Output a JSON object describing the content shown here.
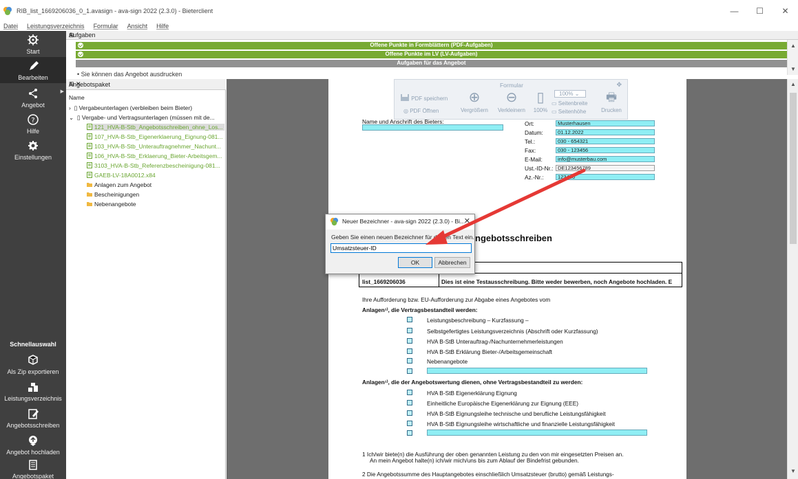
{
  "window": {
    "title": "RIB_list_1669206036_0_1.avasign - ava-sign 2022 (2.3.0) - Bieterclient",
    "controls": [
      "—",
      "☐",
      "✕"
    ]
  },
  "menu": [
    "Datei",
    "Leistungsverzeichnis",
    "Formular",
    "Ansicht",
    "Hilfe"
  ],
  "sidebar": {
    "items": [
      {
        "label": "Start",
        "icon": "gear-wheel-icon"
      },
      {
        "label": "Bearbeiten",
        "icon": "pencil-icon"
      },
      {
        "label": "Angebot",
        "icon": "share-icon"
      },
      {
        "label": "Hilfe",
        "icon": "help-icon"
      },
      {
        "label": "Einstellungen",
        "icon": "settings-icon"
      }
    ],
    "quick_title": "Schnellauswahl",
    "quick_items": [
      {
        "label": "Als Zip exportieren",
        "icon": "zip-icon"
      },
      {
        "label": "Leistungsverzeichnis",
        "icon": "coins-icon"
      },
      {
        "label": "Angebotsschreiben",
        "icon": "edit-doc-icon"
      },
      {
        "label": "Angebot hochladen",
        "icon": "upload-icon"
      },
      {
        "label": "Angebotspaket",
        "icon": "package-icon"
      }
    ]
  },
  "aufgaben": {
    "header": "Aufgaben",
    "rows": [
      "Offene Punkte in Formblättern (PDF-Aufgaben)",
      "Offene Punkte im LV (LV-Aufgaben)",
      "Aufgaben für das Angebot"
    ],
    "info": "Sie können das Angebot ausdrucken"
  },
  "tree": {
    "header": "Angebotspaket",
    "column": "Name",
    "nodes": [
      "Vergabeunterlagen (verbleiben beim Bieter)",
      "Vergabe- und Vertragsunterlagen (müssen mit de...",
      "121_HVA-B-Stb_Angebotsschreiben_ohne_Los...",
      "107_HVA-B-Stb_Eigenerklaerung_Eignung-081...",
      "103_HVA-B-Stb_Unterauftragnehmer_Nachunt...",
      "106_HVA-B-Stb_Erklaerung_Bieter-Arbeitsgem...",
      "3103_HVA-B-Stb_Referenzbescheinigung-081...",
      "GAEB-LV-18A0012.x84",
      "Anlagen zum Angebot",
      "Bescheinigungen",
      "Nebenangebote"
    ]
  },
  "toolbar": {
    "title": "Formular",
    "pdf_save": "PDF speichern",
    "pdf_open": "PDF Öffnen",
    "zoom_in": "Vergrößern",
    "zoom_out": "Verkleinern",
    "zoom_level": "100%",
    "zoom_select": "100%",
    "page_width": "Seitenbreite",
    "page_height": "Seitenhöhe",
    "print": "Drucken"
  },
  "document": {
    "bidder_label": "Name und Anschrift des Bieters:",
    "contact": [
      {
        "label": "Ort:",
        "value": "Musterhausen"
      },
      {
        "label": "Datum:",
        "value": "01.12.2022"
      },
      {
        "label": "Tel.:",
        "value": "030 - 654321"
      },
      {
        "label": "Fax:",
        "value": "030 - 123456"
      },
      {
        "label": "E-Mail:",
        "value": "info@musterbau.com"
      },
      {
        "label": "Ust.-ID-Nr.:",
        "value": "DE123456789"
      },
      {
        "label": "Az.-Nr.:",
        "value": "123456"
      }
    ],
    "heading": "ngebotsschreiben",
    "table_id": "list_1669206036",
    "table_text": "Dies ist eine Testausschreibung. Bitte weder bewerben, noch Angebote hochladen. E",
    "intro": "Ihre Aufforderung bzw. EU-Aufforderung zur Abgabe eines Angebotes vom",
    "section1_title": "Anlagen¹⁾, die Vertragsbestandteil werden:",
    "section1_items": [
      "Leistungsbeschreibung – Kurzfassung –",
      "Selbstgefertigtes Leistungsverzeichnis (Abschrift oder Kurzfassung)",
      "HVA B-StB Unterauftrag-/Nachunternehmerleistungen",
      "HVA B-StB Erklärung Bieter-/Arbeitsgemeinschaft",
      "Nebenangebote"
    ],
    "section2_title": "Anlagen¹⁾, die der Angebotswertung dienen, ohne Vertragsbestandteil zu werden:",
    "section2_items": [
      "HVA B-StB Eigenerklärung Eignung",
      "Einheitliche Europäische Eigenerklärung zur Eignung (EEE)",
      "HVA B-StB Eignungsleihe technische und berufliche Leistungsfähigkeit",
      "HVA B-StB Eignungsleihe wirtschaftliche und finanzielle Leistungsfähigkeit"
    ],
    "para1_line1": "1  Ich/wir biete(n) die Ausführung der oben genannten Leistung zu den von mir eingesetzten Preisen an.",
    "para1_line2": "An mein Angebot halte(n) ich/wir mich/uns bis zum Ablauf der Bindefrist gebunden.",
    "para2": "2  Die Angebotssumme des Hauptangebotes einschließlich Umsatzsteuer (brutto) gemäß Leistungs-"
  },
  "dialog": {
    "title": "Neuer Bezeichner - ava-sign 2022 (2.3.0) - Bi...",
    "prompt": "Geben Sie einen neuen Bezeichner für diesen Text ein.",
    "value": "Umsatzsteuer-ID",
    "ok": "OK",
    "cancel": "Abbrechen"
  },
  "colors": {
    "accent_green": "#78aa33",
    "sidebar": "#404040",
    "field_cyan": "#8feef4",
    "arrow_red": "#e53935"
  }
}
